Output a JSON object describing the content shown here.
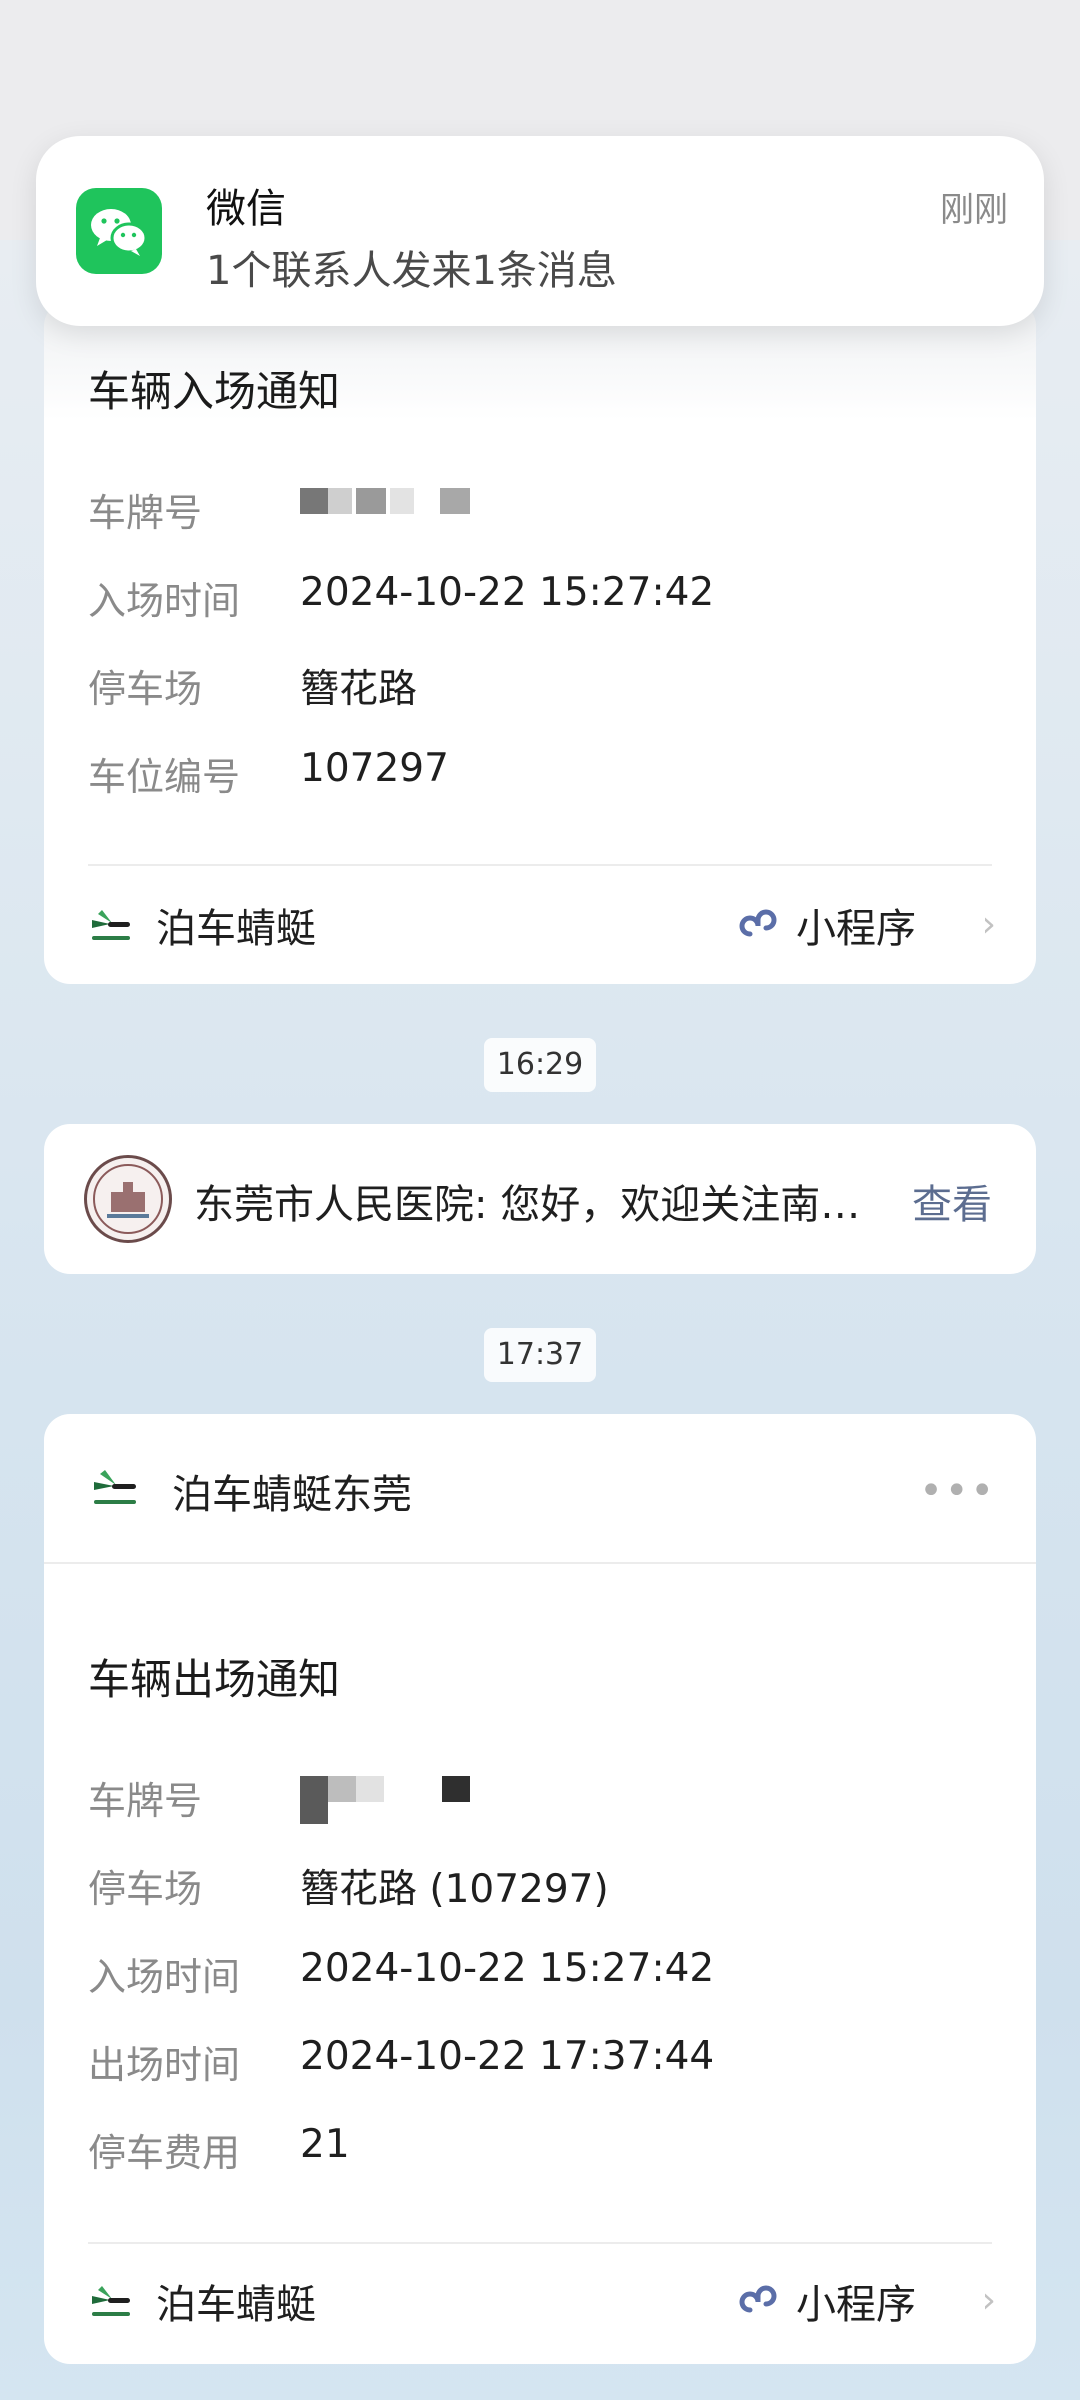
{
  "notification": {
    "app": "微信",
    "message": "1个联系人发来1条消息",
    "time": "刚刚"
  },
  "entry_card": {
    "title": "车辆入场通知",
    "rows": [
      {
        "label": "车牌号",
        "value": ""
      },
      {
        "label": "入场时间",
        "value": "2024-10-22 15:27:42"
      },
      {
        "label": "停车场",
        "value": "簪花路"
      },
      {
        "label": "车位编号",
        "value": "107297"
      }
    ],
    "brand": "泊车蜻蜓",
    "mini_program": "小程序"
  },
  "timestamps": [
    "16:29",
    "17:37"
  ],
  "hospital": {
    "text": "东莞市人民医院: 您好，欢迎关注南…",
    "action": "查看"
  },
  "exit_card": {
    "account": "泊车蜻蜓东莞",
    "more": "•••",
    "title": "车辆出场通知",
    "rows": [
      {
        "label": "车牌号",
        "value": ""
      },
      {
        "label": "停车场",
        "value": "簪花路 (107297)"
      },
      {
        "label": "入场时间",
        "value": "2024-10-22 15:27:42"
      },
      {
        "label": "出场时间",
        "value": "2024-10-22 17:37:44"
      },
      {
        "label": "停车费用",
        "value": "21"
      }
    ],
    "brand": "泊车蜻蜓",
    "mini_program": "小程序"
  },
  "colors": {
    "wechat_green": "#1fc45c",
    "link_blue": "#5c6d90",
    "mini_icon": "#5b6ea8"
  }
}
